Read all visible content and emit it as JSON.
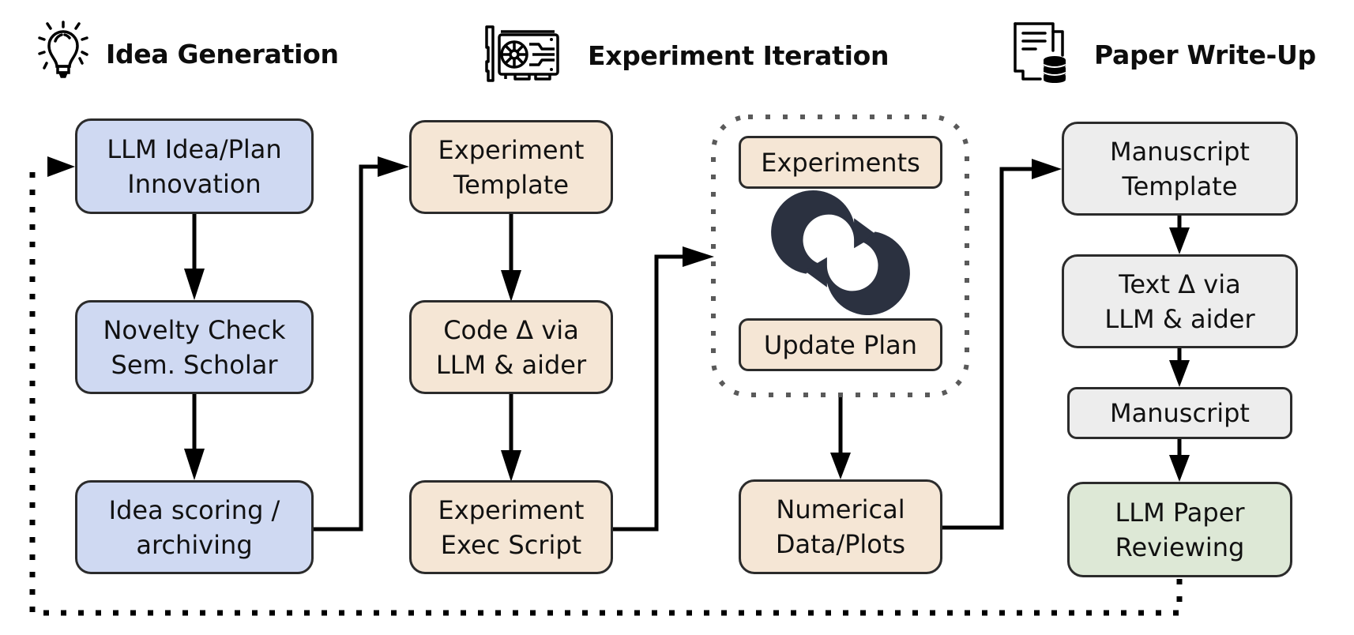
{
  "stages": [
    {
      "id": "idea",
      "title": "Idea Generation",
      "icon": "lightbulb-icon"
    },
    {
      "id": "experiment",
      "title": "Experiment Iteration",
      "icon": "gpu-card-icon"
    },
    {
      "id": "paper",
      "title": "Paper Write-Up",
      "icon": "document-database-icon"
    }
  ],
  "nodes": {
    "llm_idea": "LLM Idea/Plan\nInnovation",
    "novelty_check": "Novelty Check\nSem. Scholar",
    "idea_scoring": "Idea scoring /\narchiving",
    "experiment_template": "Experiment\nTemplate",
    "code_delta": "Code Δ via\nLLM & aider",
    "exec_script": "Experiment\nExec Script",
    "experiments": "Experiments",
    "update_plan": "Update Plan",
    "numerical_data": "Numerical\nData/Plots",
    "manuscript_template": "Manuscript\nTemplate",
    "text_delta": "Text Δ via\nLLM & aider",
    "manuscript": "Manuscript",
    "paper_reviewing": "LLM Paper\nReviewing"
  },
  "loop_icon": "cycle-arrows-icon",
  "colors": {
    "idea_fill": "#cfd9f2",
    "experiment_fill": "#f5e6d5",
    "writeup_fill": "#ededed",
    "review_fill": "#dde8d6",
    "cycle_icon": "#2b3140",
    "loop_border": "#5a5a5a"
  }
}
